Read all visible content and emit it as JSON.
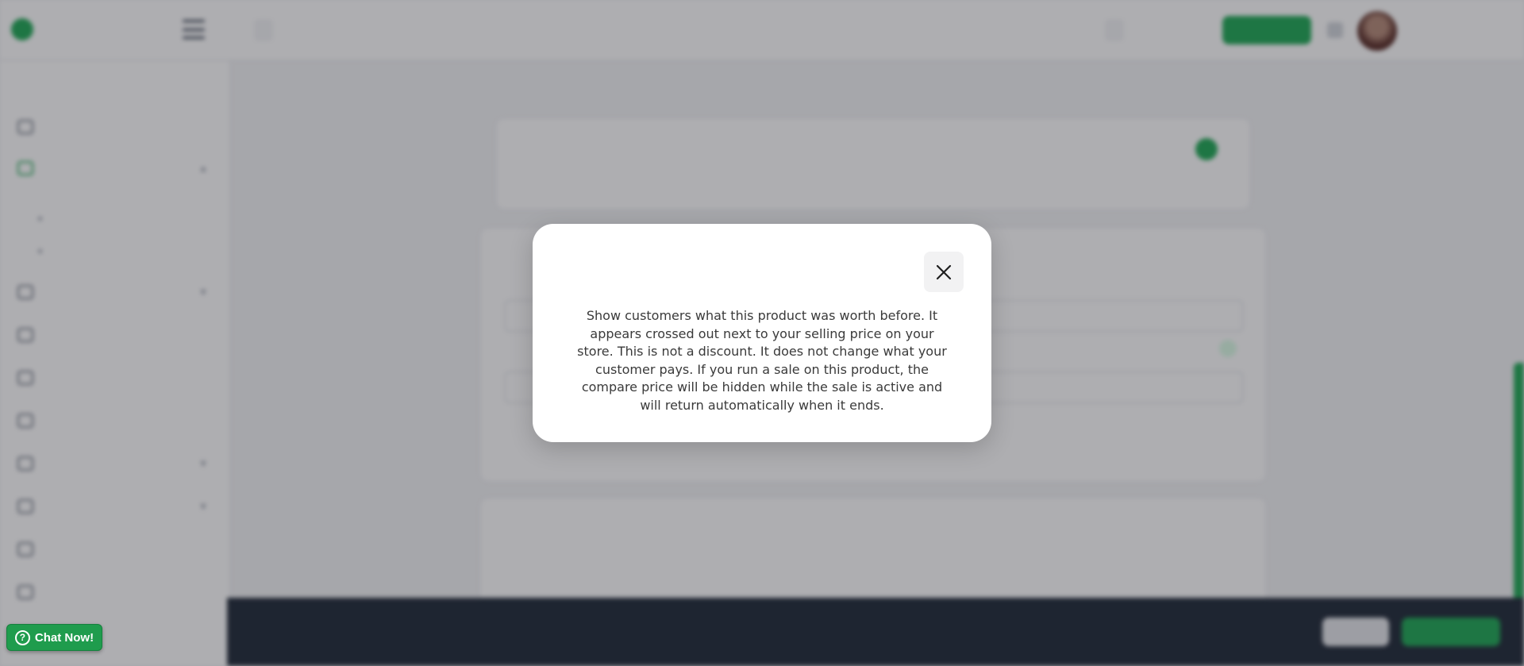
{
  "modal": {
    "body": "Show customers what this product was worth before. It appears crossed out next to your selling price on your store. This is not a discount. It does not change what your customer pays. If you run a sale on this product, the compare price will be hidden while the sale is active and will return automatically when it ends.",
    "close_icon": "close-icon"
  },
  "chat": {
    "label": "Chat Now!",
    "icon": "help-circle-icon"
  },
  "colors": {
    "brand_green": "#1fa855",
    "overlay": "rgba(31,31,40,0.36)",
    "bottom_bar": "#1f2937"
  }
}
